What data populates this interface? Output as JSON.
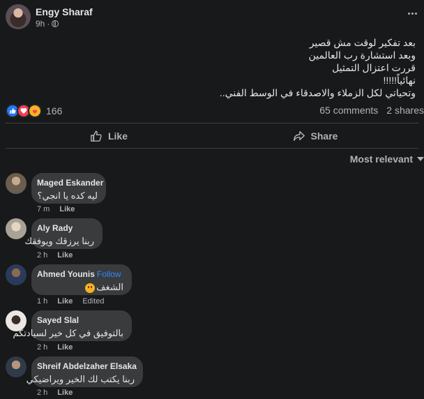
{
  "post": {
    "author": "Engy Sharaf",
    "time": "9h",
    "text_lines": [
      "بعد تفكير لوقت مش قصير",
      "وبعد استشارة رب العالمين",
      "قررت اعتزال التمثيل",
      "نهائياً!!!!!",
      "وتحياتي لكل الزملاء والاصدقاء في الوسط الفني.."
    ],
    "reaction_count": "166",
    "comments_count": "65 comments",
    "shares_count": "2 shares"
  },
  "actions": {
    "like_label": "Like",
    "share_label": "Share"
  },
  "sort": {
    "label": "Most relevant"
  },
  "comments": [
    {
      "name": "Maged Eskander",
      "text": "ليه كده يا انجي؟",
      "time": "7 m",
      "like": "Like",
      "extra": "",
      "follow": "",
      "avatar_color": "#6b5d4f"
    },
    {
      "name": "Aly Rady",
      "text": "ربنا يرزقك ويوفقك",
      "time": "2 h",
      "like": "Like",
      "extra": "",
      "follow": "",
      "avatar_color": "#c8c2b6"
    },
    {
      "name": "Ahmed Younis",
      "text": "الشغف",
      "time": "1 h",
      "like": "Like",
      "extra": "Edited",
      "follow": "Follow",
      "avatar_color": "#3a4a6a"
    },
    {
      "name": "Sayed Slal",
      "text": "بالتوفيق في كل خير لسيادتكم",
      "time": "2 h",
      "like": "Like",
      "extra": "",
      "follow": "",
      "avatar_color": "#e8e4de"
    },
    {
      "name": "Shreif Abdelzaher Elsaka",
      "text": "ربنا يكتب لك الخير ويراضيكي",
      "time": "2 h",
      "like": "Like",
      "extra": "",
      "follow": "",
      "avatar_color": "#2f3a4a"
    }
  ],
  "colors": {
    "background": "#18191a",
    "bubble": "#3a3b3c",
    "link": "#2d88ff",
    "like_reaction": "#2078f4",
    "love_reaction": "#f33e58"
  }
}
